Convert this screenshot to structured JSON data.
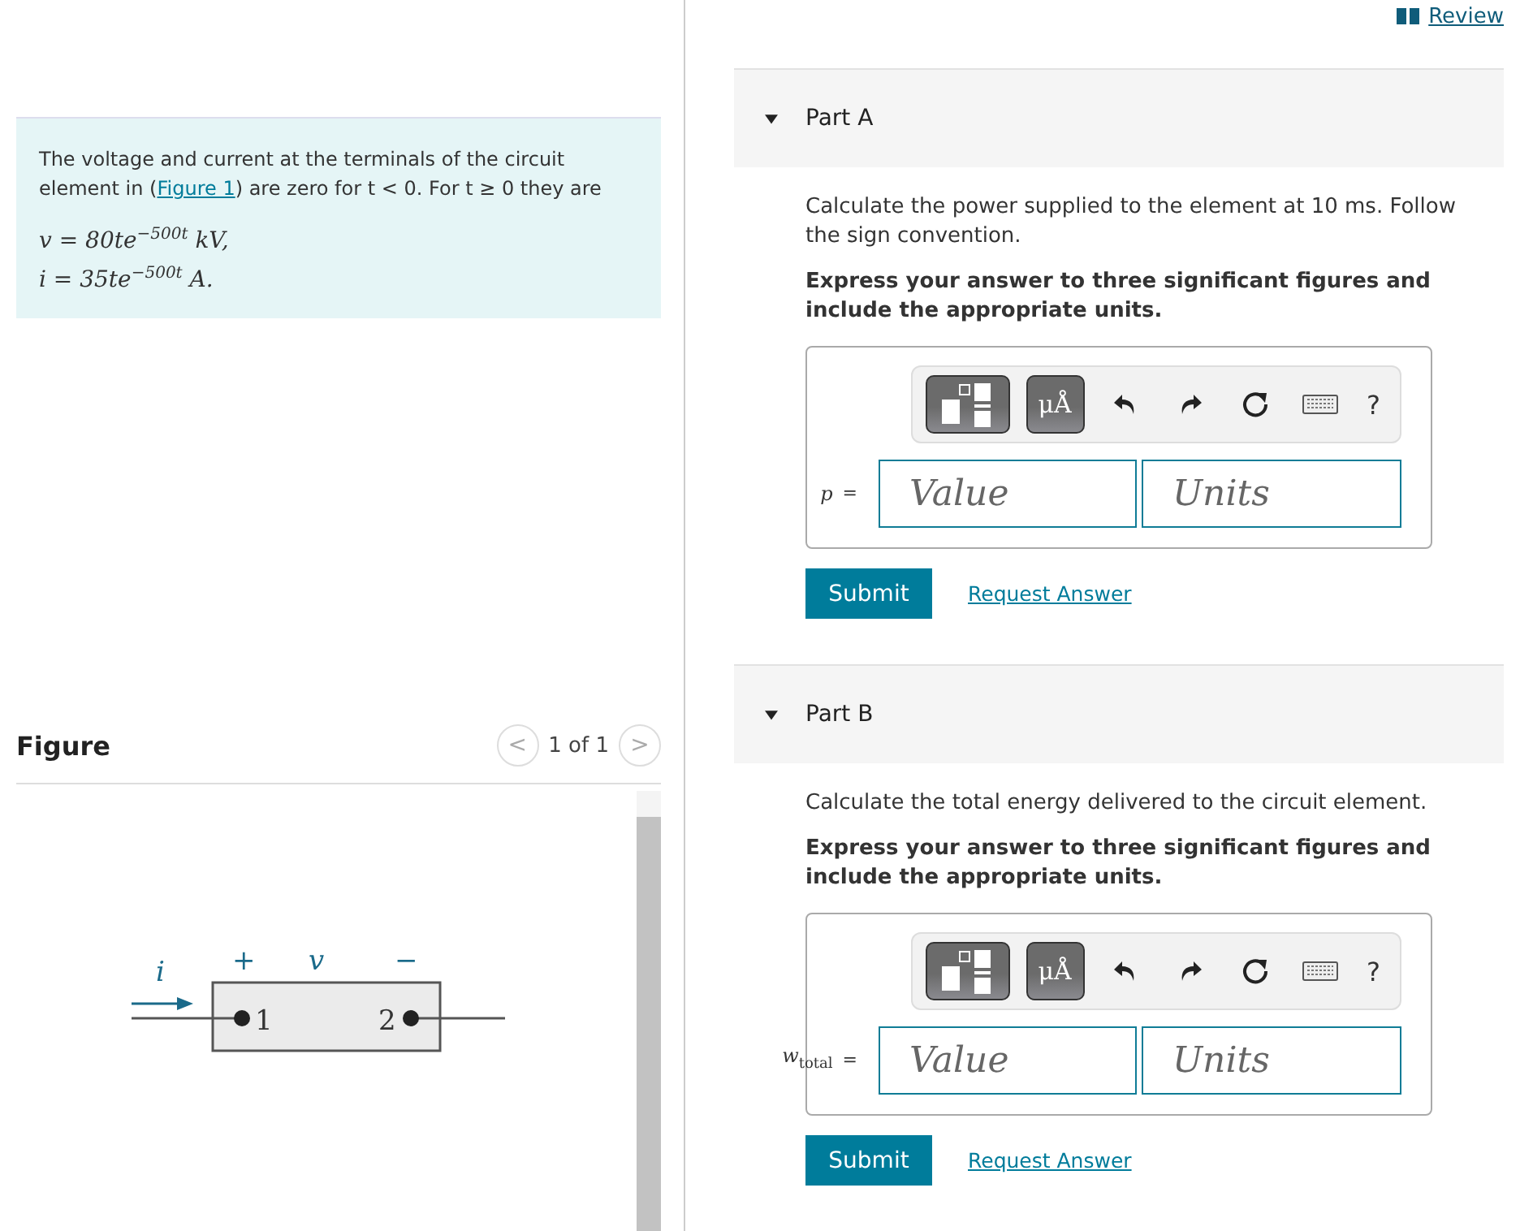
{
  "header": {
    "review_link": "Review"
  },
  "problem": {
    "text_before": "The voltage and current at the terminals of the circuit element in (",
    "figure_link": "Figure 1",
    "text_after": ") are zero for  t < 0. For t ≥ 0 they are",
    "equations": [
      "v = 80te$^{−500t}$ kV,",
      "i = 35te$^{−500t}$ A."
    ]
  },
  "figure": {
    "title": "Figure",
    "pager": "1 of 1",
    "prev": "<",
    "next": ">",
    "labels": {
      "current": "i",
      "plus": "+",
      "voltage": "v",
      "minus": "−",
      "terminal_1": "1",
      "terminal_2": "2"
    }
  },
  "parts": [
    {
      "title": "Part A",
      "expanded": true,
      "prompt": "Calculate the power supplied to the element at 10 ms. Follow the sign convention.",
      "instruction": "Express your answer to three significant figures and include the appropriate units.",
      "units_button": "μÅ",
      "help": "?",
      "variable": "p",
      "equals": "=",
      "value_placeholder": "Value",
      "units_placeholder": "Units",
      "submit": "Submit",
      "request": "Request Answer"
    },
    {
      "title": "Part B",
      "expanded": true,
      "prompt": "Calculate the total energy delivered to the circuit element.",
      "instruction": "Express your answer to three significant figures and include the appropriate units.",
      "units_button": "μÅ",
      "help": "?",
      "variable": "w$_{total}$",
      "equals": "=",
      "value_placeholder": "Value",
      "units_placeholder": "Units",
      "submit": "Submit",
      "request": "Request Answer"
    }
  ]
}
